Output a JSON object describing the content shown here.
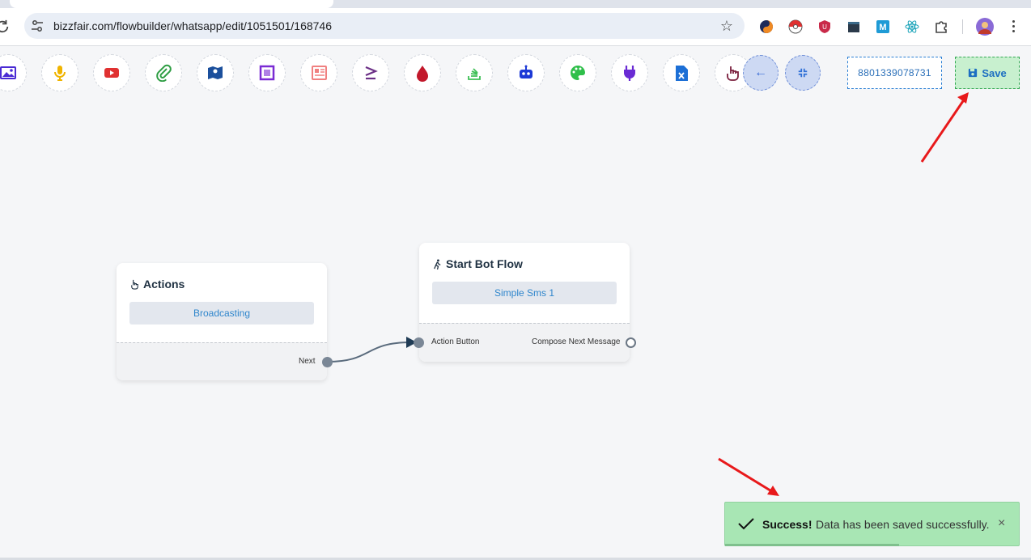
{
  "browser": {
    "url": "bizzfair.com/flowbuilder/whatsapp/edit/1051501/168746",
    "extensions": [
      "sider-icon",
      "pokeball-icon",
      "ublock-shield-icon",
      "clapperboard-icon",
      "m-extension-icon",
      "react-icon",
      "puzzle-icon"
    ]
  },
  "toolbar": {
    "tools": [
      {
        "name": "image-icon",
        "color": "#4a2bd4"
      },
      {
        "name": "microphone-icon",
        "color": "#f0b400"
      },
      {
        "name": "youtube-icon",
        "color": "#e03131"
      },
      {
        "name": "paperclip-icon",
        "color": "#2f9e44"
      },
      {
        "name": "map-icon",
        "color": "#1b4f9c"
      },
      {
        "name": "crop-frame-icon",
        "color": "#7a2bd4"
      },
      {
        "name": "newspaper-icon",
        "color": "#f08080"
      },
      {
        "name": "greater-equal-icon",
        "color": "#6b2f86"
      },
      {
        "name": "drop-icon",
        "color": "#c2182b"
      },
      {
        "name": "stack-icon",
        "color": "#40c057"
      },
      {
        "name": "robot-icon",
        "color": "#1c39d6"
      },
      {
        "name": "palette-icon",
        "color": "#2fbf4a"
      },
      {
        "name": "plug-icon",
        "color": "#6a2bd4"
      },
      {
        "name": "excel-file-icon",
        "color": "#1c6fd6"
      },
      {
        "name": "hand-pointer-icon",
        "color": "#7a1f3d"
      }
    ],
    "phone_number": "8801339078731",
    "save_label": "Save"
  },
  "nodes": {
    "actions": {
      "title": "Actions",
      "button": "Broadcasting",
      "output_label": "Next"
    },
    "start_bot_flow": {
      "title": "Start Bot Flow",
      "button": "Simple Sms 1",
      "input_label": "Action Button",
      "output_label": "Compose Next Message"
    }
  },
  "toast": {
    "title": "Success!",
    "message": "Data has been saved successfully.",
    "close": "×"
  }
}
